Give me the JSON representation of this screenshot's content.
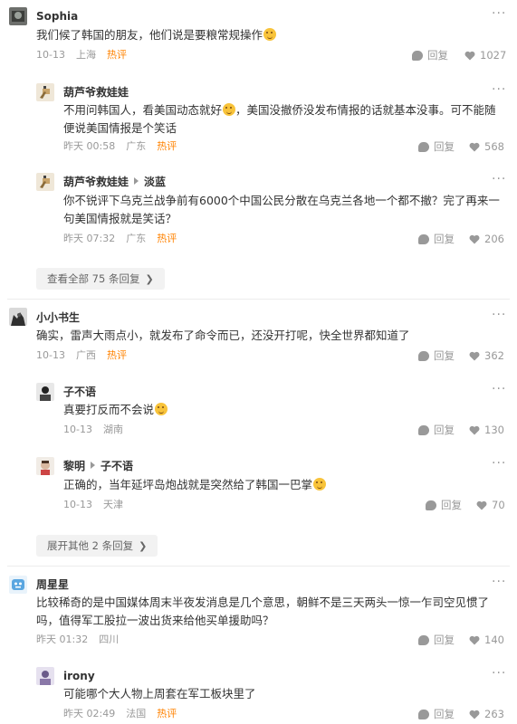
{
  "colors": {
    "hot": "#ff8200",
    "meta": "#999999",
    "text": "#333333"
  },
  "threads": [
    {
      "user": "Sophia",
      "text": "我们候了韩国的朋友，他们说是要粮常规操作",
      "date": "10-13",
      "location": "上海",
      "hot": "热评",
      "reply_label": "回复",
      "likes": "1027",
      "replies": [
        {
          "user": "葫芦爷救娃娃",
          "text_a": "不用问韩国人，看美国动态就好",
          "text_b": "，美国没撤侨没发布情报的话就基本没事。可不能随便说美国情报是个笑话",
          "date": "昨天 00:58",
          "location": "广东",
          "hot": "热评",
          "reply_label": "回复",
          "likes": "568"
        },
        {
          "user": "葫芦爷救娃娃",
          "reply_to": "淡蓝",
          "text": "你不锐评下乌克兰战争前有6000个中国公民分散在乌克兰各地一个都不撤？完了再来一句美国情报就是笑话？",
          "date": "昨天 07:32",
          "location": "广东",
          "hot": "热评",
          "reply_label": "回复",
          "likes": "206"
        }
      ],
      "view_all": "查看全部 75 条回复"
    },
    {
      "user": "小小书生",
      "text": "确实，雷声大雨点小，就发布了命令而已，还没开打呢，快全世界都知道了",
      "date": "10-13",
      "location": "广西",
      "hot": "热评",
      "reply_label": "回复",
      "likes": "362",
      "replies": [
        {
          "user": "子不语",
          "text": "真要打反而不会说",
          "date": "10-13",
          "location": "湖南",
          "reply_label": "回复",
          "likes": "130"
        },
        {
          "user": "黎明",
          "reply_to": "子不语",
          "text": "正确的，当年延坪岛炮战就是突然给了韩国一巴掌",
          "date": "10-13",
          "location": "天津",
          "reply_label": "回复",
          "likes": "70"
        }
      ],
      "view_all": "展开其他 2 条回复"
    },
    {
      "user": "周星星",
      "text": "比较稀奇的是中国媒体周末半夜发消息是几个意思，朝鲜不是三天两头一惊一乍司空见惯了吗，值得军工股拉一波出货来给他买单援助吗？",
      "date": "昨天 01:32",
      "location": "四川",
      "reply_label": "回复",
      "likes": "140",
      "replies": [
        {
          "user": "irony",
          "text": "可能哪个大人物上周套在军工板块里了",
          "date": "昨天 02:49",
          "location": "法国",
          "hot": "热评",
          "reply_label": "回复",
          "likes": "263"
        }
      ]
    }
  ]
}
